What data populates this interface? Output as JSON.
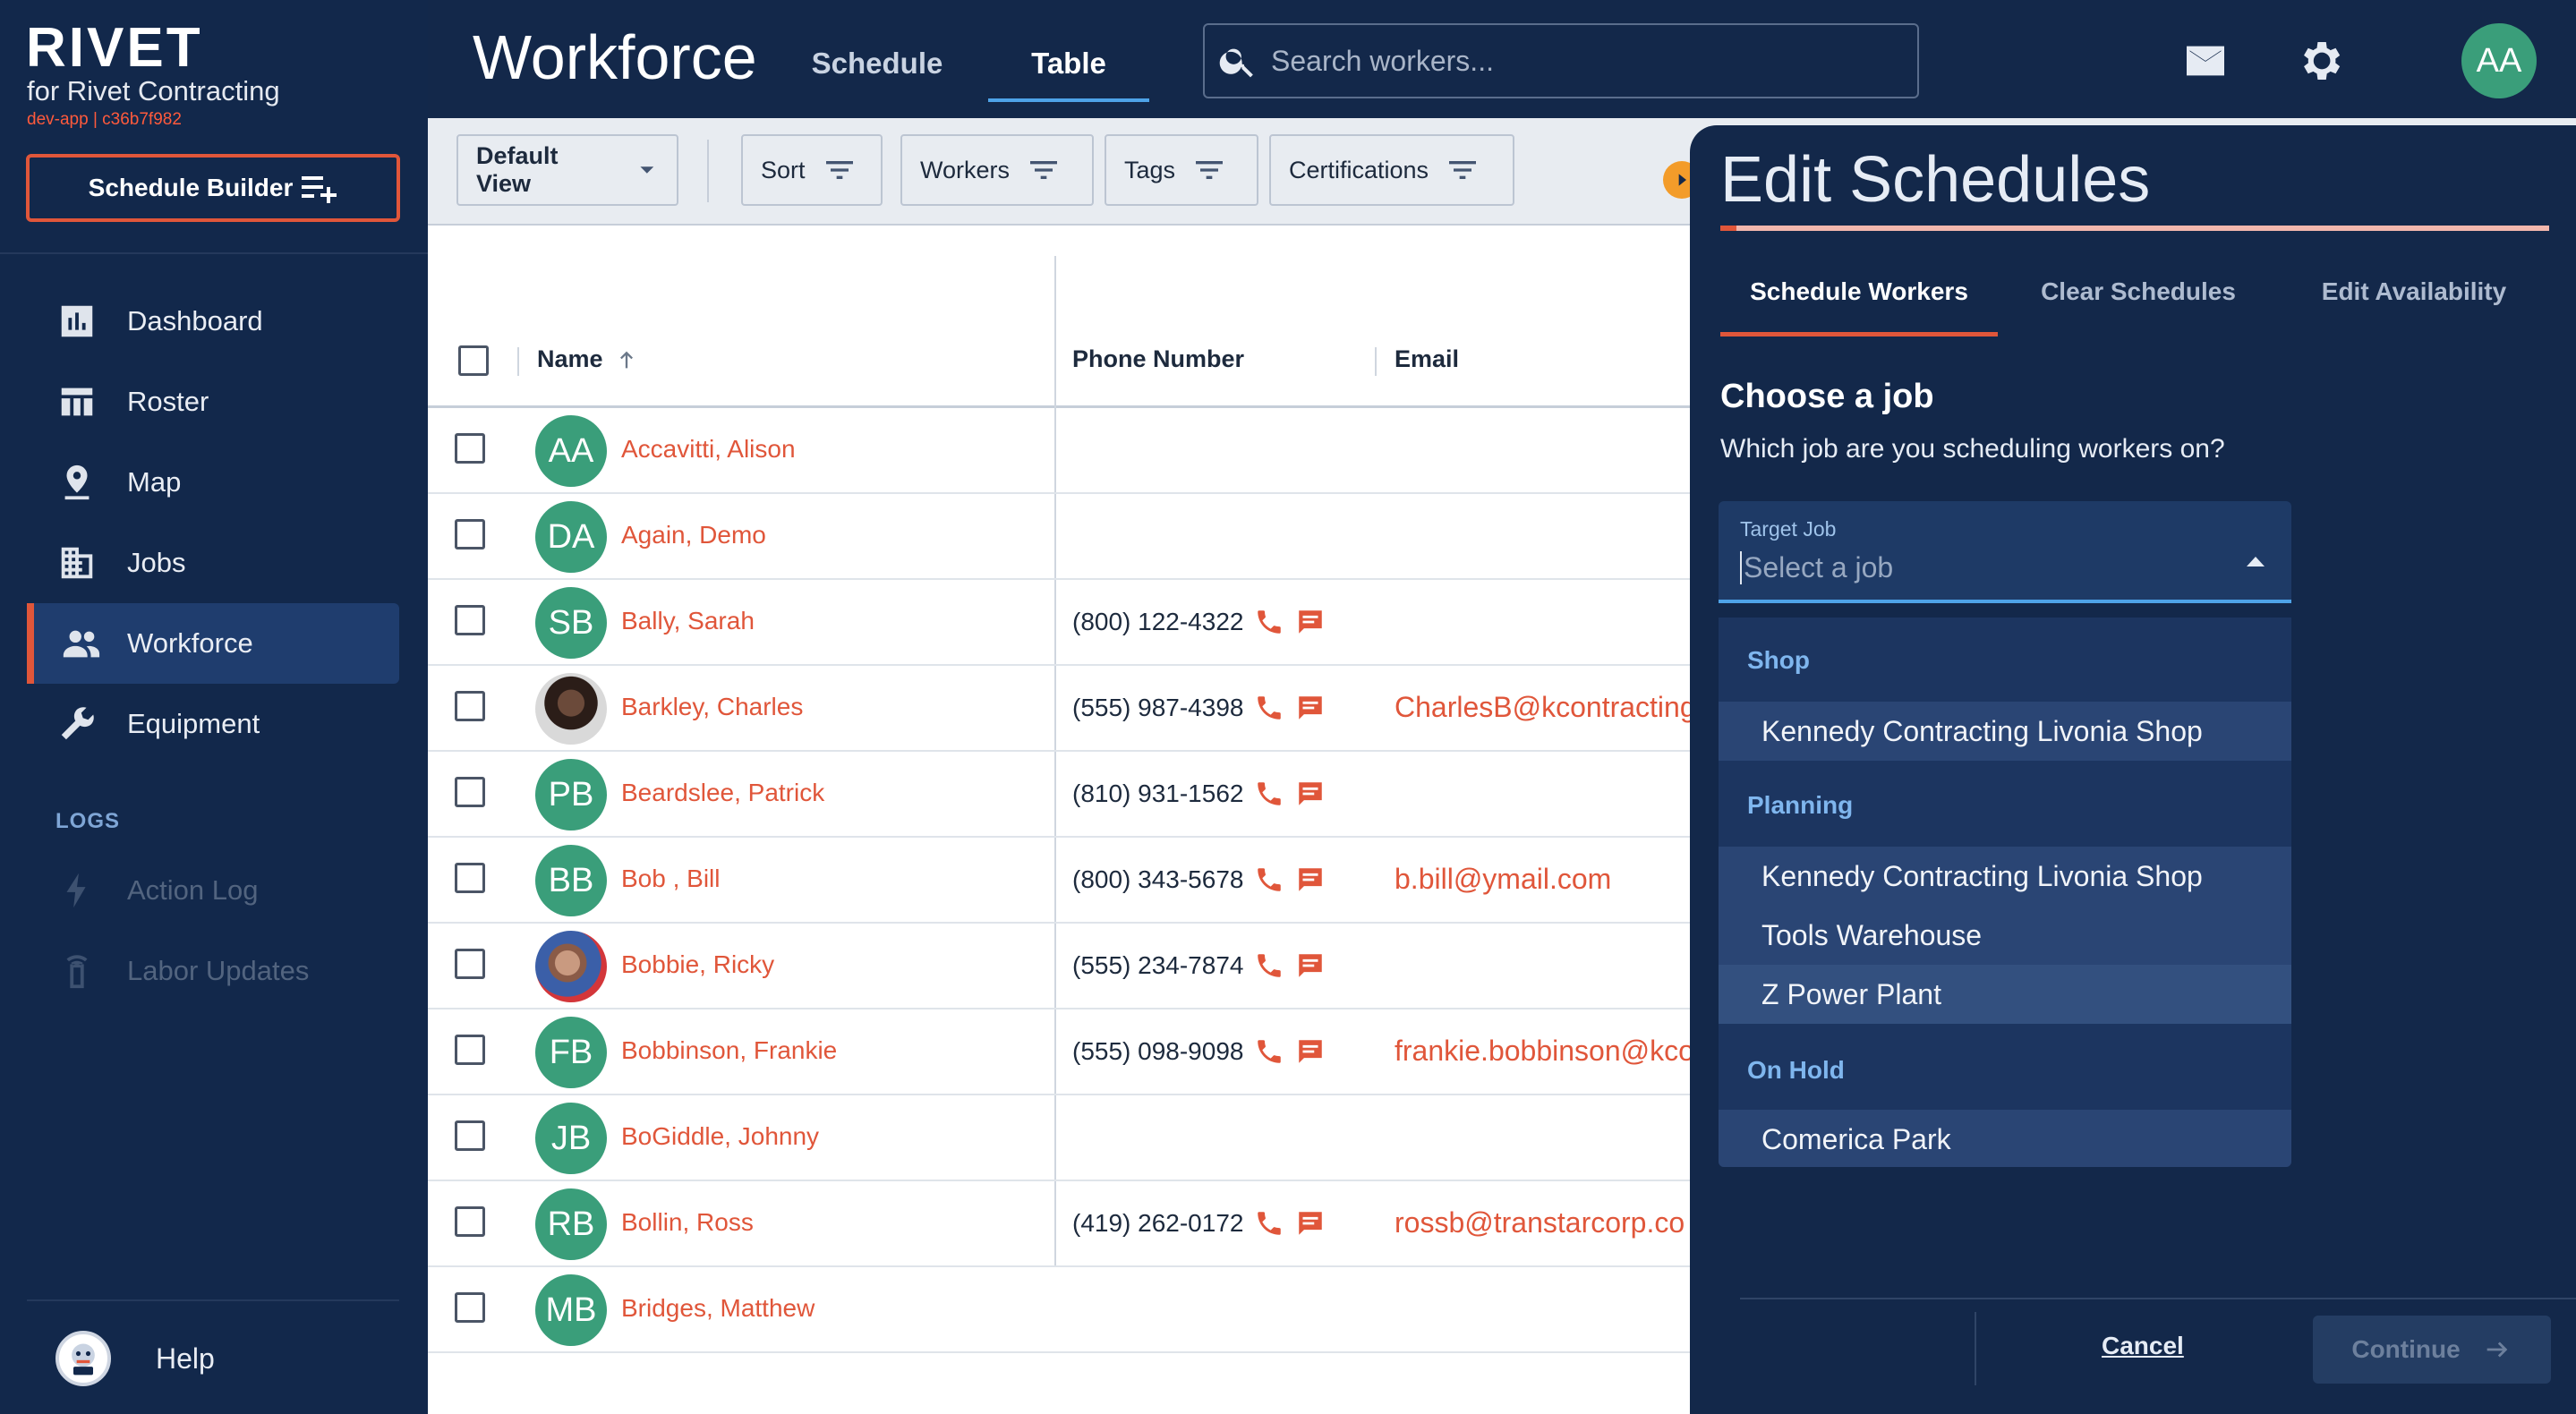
{
  "brand": {
    "logo": "RIVET",
    "tenant": "for Rivet Contracting",
    "build": "dev-app | c36b7f982"
  },
  "sidebar": {
    "schedule_builder_label": "Schedule Builder",
    "items": [
      {
        "label": "Dashboard",
        "icon": "dashboard-icon"
      },
      {
        "label": "Roster",
        "icon": "roster-icon"
      },
      {
        "label": "Map",
        "icon": "map-pin-icon"
      },
      {
        "label": "Jobs",
        "icon": "building-icon"
      },
      {
        "label": "Workforce",
        "icon": "people-icon",
        "active": true
      },
      {
        "label": "Equipment",
        "icon": "wrench-icon"
      }
    ],
    "logs_label": "LOGS",
    "log_items": [
      {
        "label": "Action Log",
        "icon": "lightning-icon"
      },
      {
        "label": "Labor Updates",
        "icon": "device-icon"
      }
    ],
    "help_label": "Help"
  },
  "header": {
    "title": "Workforce",
    "tabs": [
      {
        "label": "Schedule"
      },
      {
        "label": "Table",
        "active": true
      }
    ],
    "search_placeholder": "Search workers...",
    "user_initials": "AA"
  },
  "filters": {
    "view_label": "Default View",
    "sort_label": "Sort",
    "workers_label": "Workers",
    "tags_label": "Tags",
    "certifications_label": "Certifications"
  },
  "table": {
    "columns": {
      "name": "Name",
      "phone": "Phone Number",
      "email": "Email"
    },
    "rows": [
      {
        "initials": "AA",
        "name": "Accavitti, Alison",
        "phone": "",
        "email": ""
      },
      {
        "initials": "DA",
        "name": "Again, Demo",
        "phone": "",
        "email": ""
      },
      {
        "initials": "SB",
        "name": "Bally, Sarah",
        "phone": "(800) 122-4322",
        "email": ""
      },
      {
        "initials": "",
        "name": "Barkley, Charles",
        "phone": "(555) 987-4398",
        "email": "CharlesB@kcontracting",
        "photo": "a"
      },
      {
        "initials": "PB",
        "name": "Beardslee, Patrick",
        "phone": "(810) 931-1562",
        "email": ""
      },
      {
        "initials": "BB",
        "name": "Bob , Bill",
        "phone": "(800) 343-5678",
        "email": "b.bill@ymail.com"
      },
      {
        "initials": "",
        "name": "Bobbie, Ricky",
        "phone": "(555) 234-7874",
        "email": "",
        "photo": "b"
      },
      {
        "initials": "FB",
        "name": "Bobbinson, Frankie",
        "phone": "(555) 098-9098",
        "email": "frankie.bobbinson@kco"
      },
      {
        "initials": "JB",
        "name": "BoGiddle, Johnny",
        "phone": "",
        "email": ""
      },
      {
        "initials": "RB",
        "name": "Bollin, Ross",
        "phone": "(419) 262-0172",
        "email": "rossb@transtarcorp.co"
      },
      {
        "initials": "MB",
        "name": "Bridges, Matthew",
        "phone": "",
        "email": ""
      }
    ]
  },
  "panel": {
    "title": "Edit Schedules",
    "tabs": [
      {
        "label": "Schedule Workers",
        "active": true
      },
      {
        "label": "Clear Schedules"
      },
      {
        "label": "Edit Availability"
      }
    ],
    "choose_title": "Choose a job",
    "choose_subtitle": "Which job are you scheduling workers on?",
    "select_label": "Target Job",
    "select_placeholder": "Select a job",
    "groups": [
      {
        "label": "Shop",
        "options": [
          "Kennedy Contracting Livonia Shop"
        ]
      },
      {
        "label": "Planning",
        "options": [
          "Kennedy Contracting Livonia Shop",
          "Tools Warehouse",
          "Z Power Plant"
        ]
      },
      {
        "label": "On Hold",
        "options": [
          "Comerica Park"
        ]
      }
    ],
    "cancel_label": "Cancel",
    "continue_label": "Continue"
  }
}
